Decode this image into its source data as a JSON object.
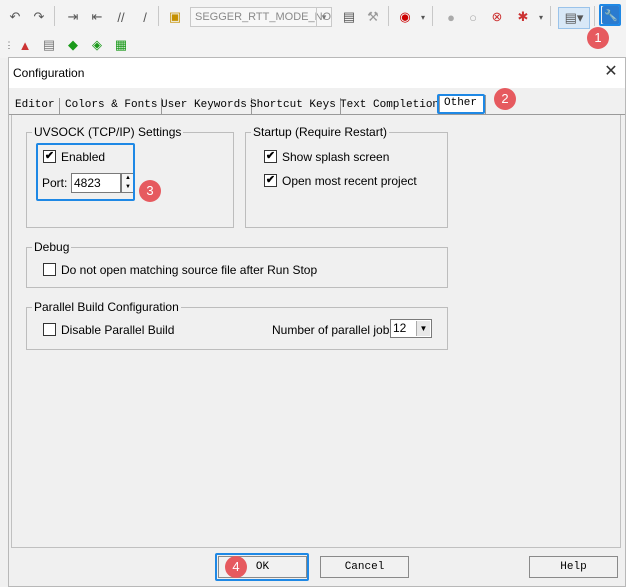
{
  "toolbar": {
    "target_combo": "SEGGER_RTT_MODE_NO_",
    "icons_row1": [
      "undo-icon",
      "redo-icon",
      "indent-icon",
      "unindent-icon",
      "comment-icon",
      "uncomment-icon",
      "open-file-icon",
      "find-icon",
      "debug-icon",
      "breakpoint-icon",
      "disable-breakpoint-icon",
      "kill-breakpoints-icon",
      "run-icon",
      "window-layout-icon",
      "configuration-icon"
    ],
    "icons_row2": [
      "build-icon",
      "rebuild-icon",
      "download-icon",
      "erase-icon",
      "pack-installer-icon"
    ]
  },
  "dialog": {
    "title": "Configuration",
    "close_glyph": "✕",
    "tabs": [
      "Editor",
      "Colors & Fonts",
      "User Keywords",
      "Shortcut Keys",
      "Text Completion",
      "Other"
    ],
    "active_tab": "Other",
    "uvsock": {
      "legend": "UVSOCK (TCP/IP) Settings",
      "enabled_label": "Enabled",
      "enabled": true,
      "port_label": "Port:",
      "port_value": "4823"
    },
    "startup": {
      "legend": "Startup (Require Restart)",
      "splash_label": "Show splash screen",
      "splash": true,
      "recent_label": "Open most recent project",
      "recent": true
    },
    "debug": {
      "legend": "Debug",
      "no_source_label": "Do not open matching source file after Run Stop",
      "no_source": false
    },
    "parallel": {
      "legend": "Parallel Build Configuration",
      "disable_label": "Disable Parallel Build",
      "disable": false,
      "jobs_label": "Number of parallel jobs:",
      "jobs_value": "12"
    },
    "buttons": {
      "ok": "OK",
      "cancel": "Cancel",
      "help": "Help"
    }
  },
  "annotations": {
    "badge1": "1",
    "badge2": "2",
    "badge3": "3",
    "badge4": "4"
  },
  "colors": {
    "highlight": "#1e88e5",
    "badge": "#e65a5f"
  }
}
